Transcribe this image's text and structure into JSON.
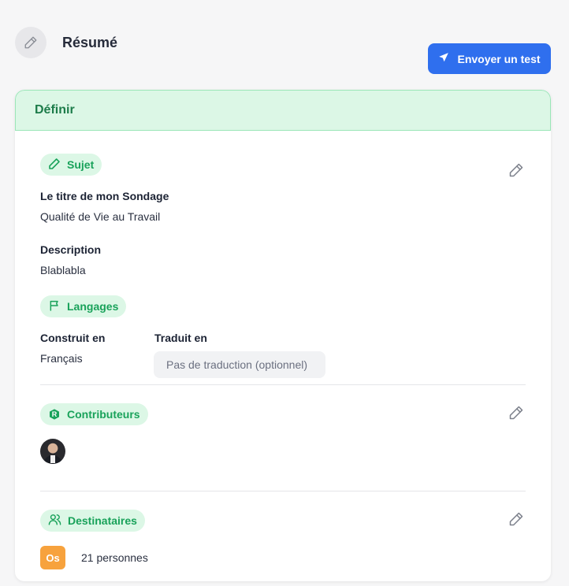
{
  "header": {
    "title": "Résumé",
    "send_test_label": "Envoyer un test"
  },
  "card": {
    "section_title": "Définir",
    "subject": {
      "pill_label": "Sujet",
      "title_label": "Le titre de mon Sondage",
      "title_value": "Qualité de Vie au Travail",
      "description_label": "Description",
      "description_value": "Blablabla"
    },
    "languages": {
      "pill_label": "Langages",
      "built_in_label": "Construit en",
      "built_in_value": "Français",
      "translated_label": "Traduit en",
      "translated_placeholder": "Pas de traduction (optionnel)"
    },
    "contributors": {
      "pill_label": "Contributeurs",
      "badge_letter": "R"
    },
    "recipients": {
      "pill_label": "Destinataires",
      "org_initials": "Os",
      "count_text": "21 personnes"
    }
  },
  "colors": {
    "accent_blue": "#2f6fee",
    "green_text": "#19a25a",
    "green_bg": "#dcf7e6",
    "orange": "#f7a23d"
  },
  "icons": [
    "pencil-icon",
    "send-icon",
    "flag-icon",
    "shield-icon",
    "users-icon"
  ]
}
